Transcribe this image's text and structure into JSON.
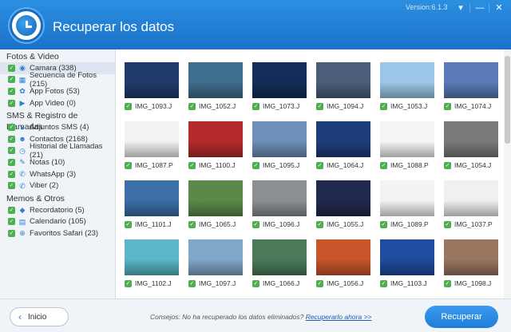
{
  "header": {
    "title": "Recuperar los datos",
    "version": "Version:6.1.3"
  },
  "sidebar": {
    "categories": [
      {
        "title": "Fotos & Video",
        "items": [
          {
            "label": "Camara (338)",
            "icon": "camera-icon",
            "active": true
          },
          {
            "label": "Secuencia de Fotos (215)",
            "icon": "photo-stream-icon"
          },
          {
            "label": "App Fotos (53)",
            "icon": "photos-icon"
          },
          {
            "label": "App Video (0)",
            "icon": "video-icon"
          }
        ]
      },
      {
        "title": "SMS & Registro de Llamadas",
        "items": [
          {
            "label": "Adjuntos SMS (4)",
            "icon": "message-icon"
          },
          {
            "label": "Contactos (2168)",
            "icon": "contact-icon"
          },
          {
            "label": "Historial de Llamadas (21)",
            "icon": "clock-icon"
          },
          {
            "label": "Notas (10)",
            "icon": "pencil-icon"
          },
          {
            "label": "WhatsApp (3)",
            "icon": "whatsapp-icon"
          },
          {
            "label": "Viber (2)",
            "icon": "viber-icon"
          }
        ]
      },
      {
        "title": "Memos & Otros",
        "items": [
          {
            "label": "Recordatorio (5)",
            "icon": "reminder-icon"
          },
          {
            "label": "Calendario (105)",
            "icon": "calendar-icon"
          },
          {
            "label": "Favoritos Safari (23)",
            "icon": "compass-icon"
          }
        ]
      }
    ]
  },
  "photos": [
    "IMG_1093.J",
    "IMG_1052.J",
    "IMG_1073.J",
    "IMG_1094.J",
    "IMG_1053.J",
    "IMG_1074.J",
    "IMG_1087.P",
    "IMG_1100.J",
    "IMG_1095.J",
    "IMG_1064.J",
    "IMG_1088.P",
    "IMG_1054.J",
    "IMG_1101.J",
    "IMG_1065.J",
    "IMG_1096.J",
    "IMG_1055.J",
    "IMG_1089.P",
    "IMG_1037.P",
    "IMG_1102.J",
    "IMG_1097.J",
    "IMG_1066.J",
    "IMG_1056.J",
    "IMG_1103.J",
    "IMG_1098.J"
  ],
  "thumb_colors": [
    "#1f3a6b",
    "#3f6e8e",
    "#142c5a",
    "#4a5e7a",
    "#9cc7e8",
    "#5a7bb8",
    "#f2f2f2",
    "#b52b2b",
    "#6d8fb8",
    "#1d3d7a",
    "#f5f5f5",
    "#7a7a7a",
    "#3c6ea8",
    "#5a8a4a",
    "#8a8f94",
    "#22294e",
    "#f3f3f3",
    "#f0f0f0",
    "#5ab6c8",
    "#7fa7c8",
    "#4a7a5a",
    "#c9552b",
    "#1e4c9e",
    "#9a7560"
  ],
  "footer": {
    "back_label": "Inicio",
    "tip_text": "Consejos: No ha recuperado los datos eliminados?",
    "tip_link": "Recuperarlo ahora >>",
    "recover_label": "Recuperar"
  }
}
